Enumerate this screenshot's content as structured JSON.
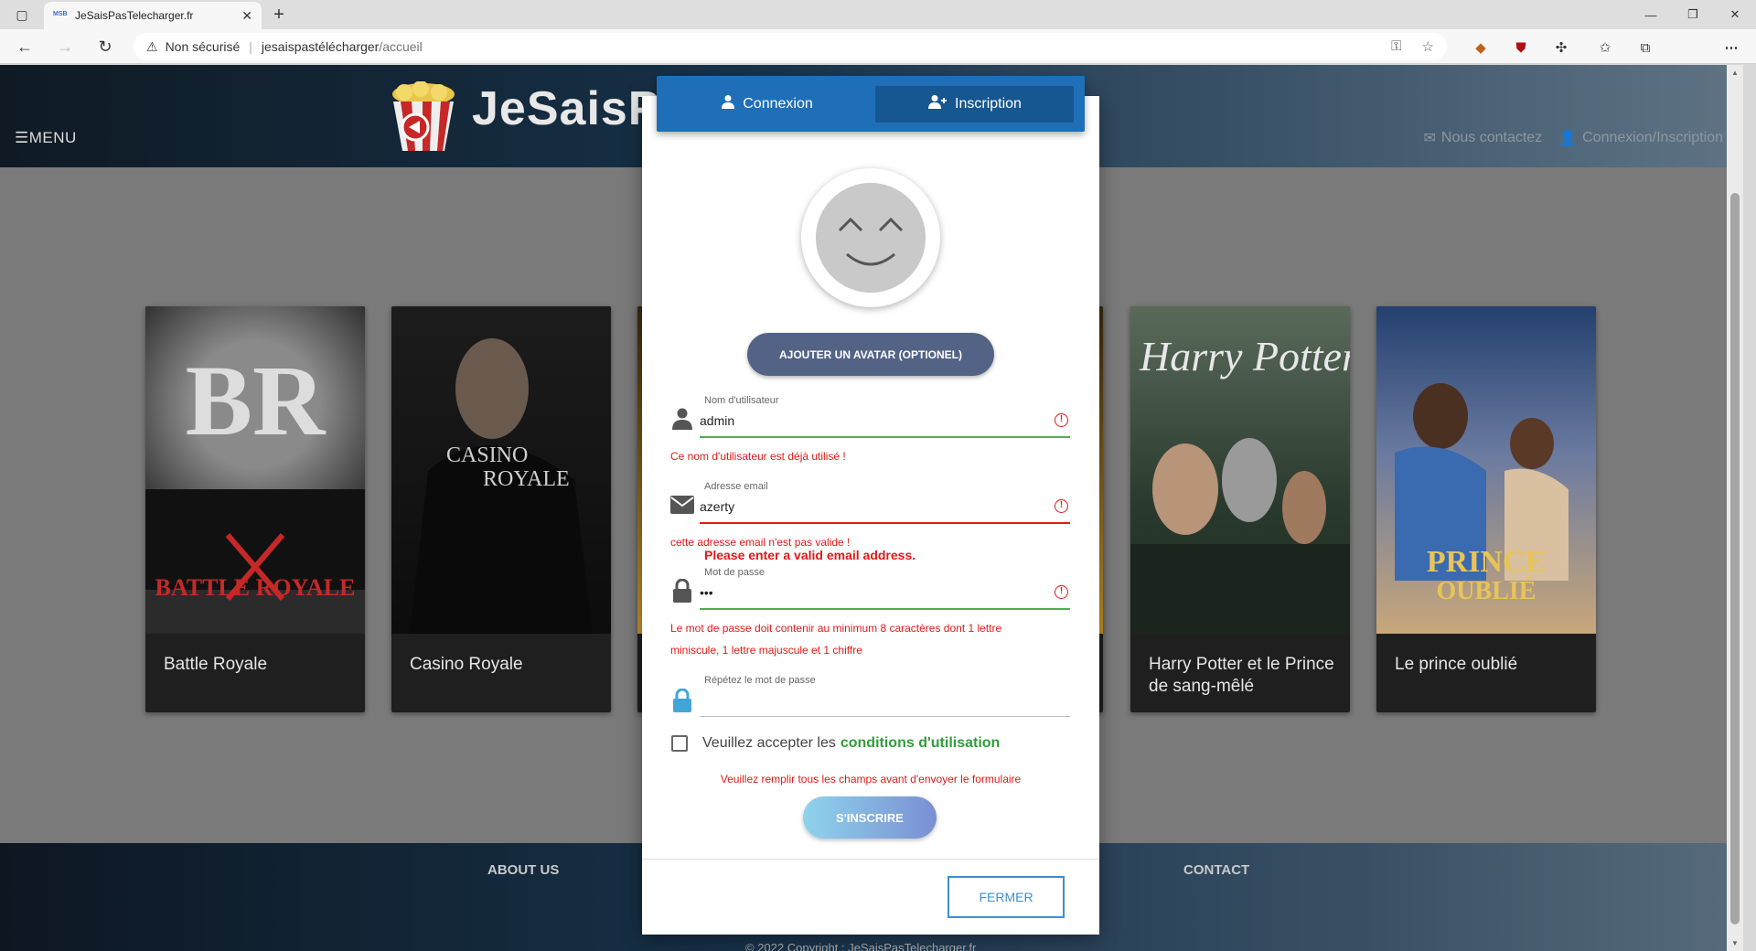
{
  "browser": {
    "tab_title": "JeSaisPasTelecharger.fr",
    "favicon_text": "MSB",
    "security_label": "Non sécurisé",
    "url_host": "jesaispastélécharger",
    "url_path": "/accueil"
  },
  "header": {
    "menu_label": "MENU",
    "logo_text": "JeSaisP",
    "contact_label": "Nous contactez",
    "login_label": "Connexion/Inscription"
  },
  "movies": [
    {
      "title": "Battle Royale",
      "poster_colors": [
        "#2b2b2b",
        "#6e6e6e"
      ]
    },
    {
      "title": "Casino Royale",
      "poster_colors": [
        "#101010",
        "#3b3b3b"
      ]
    },
    {
      "title": "",
      "poster_colors": [
        "#3a2a10",
        "#c9962a"
      ]
    },
    {
      "title": "",
      "poster_colors": [
        "#3a2a10",
        "#c9962a"
      ]
    },
    {
      "title": "Harry Potter et le Prince de sang-mêlé",
      "poster_colors": [
        "#2e3b2c",
        "#8a9a7a"
      ]
    },
    {
      "title": "Le prince oublié",
      "poster_colors": [
        "#2a4a80",
        "#c8a77a"
      ]
    }
  ],
  "footer": {
    "about": "ABOUT US",
    "contact": "CONTACT",
    "copyright": "© 2022 Copyright : JeSaisPasTelecharger.fr"
  },
  "modal": {
    "tab_login": "Connexion",
    "tab_register": "Inscription",
    "avatar_button": "AJOUTER UN AVATAR (OPTIONEL)",
    "username": {
      "label": "Nom d'utilisateur",
      "value": "admin",
      "error": "Ce nom d'utilisateur est déjà utilisé !"
    },
    "email": {
      "label": "Adresse email",
      "value": "azerty",
      "error": "cette adresse email n'est pas valide !",
      "browser_error": "Please enter a valid email address."
    },
    "password": {
      "label": "Mot de passe",
      "value": "•••",
      "error_line1": "Le mot de passe doit contenir au minimum 8 caractères dont 1 lettre",
      "error_line2": "miniscule, 1 lettre majuscule et 1 chiffre"
    },
    "password_repeat": {
      "label": "Répétez le mot de passe",
      "value": ""
    },
    "terms_prefix": "Veuillez accepter les",
    "terms_link": "conditions d'utilisation",
    "form_error": "Veuillez remplir tous les champs avant d'envoyer le formulaire",
    "submit": "S'INSCRIRE",
    "close": "FERMER"
  },
  "colors": {
    "accent_blue": "#1e6fb8",
    "error_red": "#e31919",
    "valid_green": "#4caf50",
    "terms_green": "#2f9e3a"
  }
}
